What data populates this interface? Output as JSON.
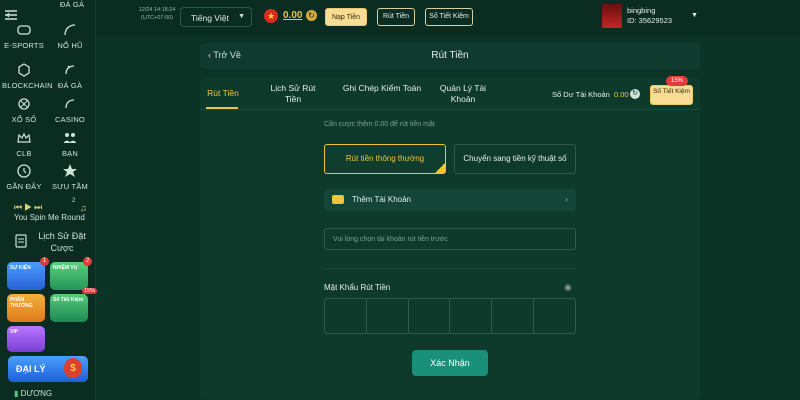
{
  "sidebar": {
    "items": [
      {
        "label": "ĐÁ GÀ",
        "icon": "rooster-icon"
      },
      {
        "label": "E-SPORTS",
        "icon": "esports-icon"
      },
      {
        "label": "NỔ HŨ",
        "icon": "slot-icon"
      },
      {
        "label": "BLOCKCHAIN",
        "icon": "blockchain-icon"
      },
      {
        "label": "ĐÁ GÀ",
        "icon": "rooster-icon"
      },
      {
        "label": "XỔ SỐ",
        "icon": "lottery-icon"
      },
      {
        "label": "CASINO",
        "icon": "casino-icon"
      },
      {
        "label": "CLB",
        "icon": "crown-icon"
      },
      {
        "label": "BẠN",
        "icon": "friends-icon"
      },
      {
        "label": "GẦN ĐÂY",
        "icon": "clock-icon"
      },
      {
        "label": "SƯU TẦM",
        "icon": "star-icon"
      }
    ],
    "spin_label": "You Spin Me Round",
    "spin_count": "2",
    "history_label": "Lịch Sử Đặt Cược",
    "promos": [
      {
        "label": "SỰ KIỆN",
        "badge": "1"
      },
      {
        "label": "NHIỆM VỤ",
        "badge": "2"
      },
      {
        "label": "PHẦN THƯỞNG",
        "badge": ""
      },
      {
        "label": "Số Tiết Kiệm",
        "badge": "15%"
      },
      {
        "label": "VIP",
        "badge": ""
      }
    ],
    "daily_label": "ĐẠI LÝ",
    "bottom_label": "DƯƠNG"
  },
  "topbar": {
    "datetime": "12/24 14:18:24",
    "timezone": "(UTC+07:00)",
    "language": "Tiếng Việt",
    "balance": "0.00",
    "deposit_label": "Nạp Tiền",
    "withdraw_label": "Rút Tiền",
    "savings_label": "Số Tiết Kiệm",
    "username": "bingbing",
    "user_id": "ID: 35629523"
  },
  "header": {
    "back_label": "Trở Về",
    "title": "Rút Tiền"
  },
  "tabs": [
    {
      "label": "Rút Tiền",
      "active": true
    },
    {
      "label": "Lịch Sử Rút Tiền",
      "active": false
    },
    {
      "label": "Ghi Chép Kiểm Toán",
      "active": false
    },
    {
      "label": "Quản Lý Tài Khoản",
      "active": false
    }
  ],
  "account_balance": {
    "label": "Số Dư Tài Khoản",
    "value": "0.00"
  },
  "savings_button": {
    "label": "Số Tiết Kiệm",
    "badge": "15%"
  },
  "form": {
    "hint": "Cần cược thêm 0.00 để rút tiền mặt",
    "method_normal": "Rút tiền thông thường",
    "method_digital": "Chuyển sang tiền kỹ thuật số",
    "add_account": "Thêm Tài Khoản",
    "account_placeholder": "Vui lòng chọn tài khoản rút tiền trước",
    "password_label": "Mật Khẩu Rút Tiền",
    "confirm_label": "Xác Nhận"
  },
  "colors": {
    "accent": "#f0c33c",
    "primary": "#1a8f79",
    "background": "#0b3326"
  }
}
